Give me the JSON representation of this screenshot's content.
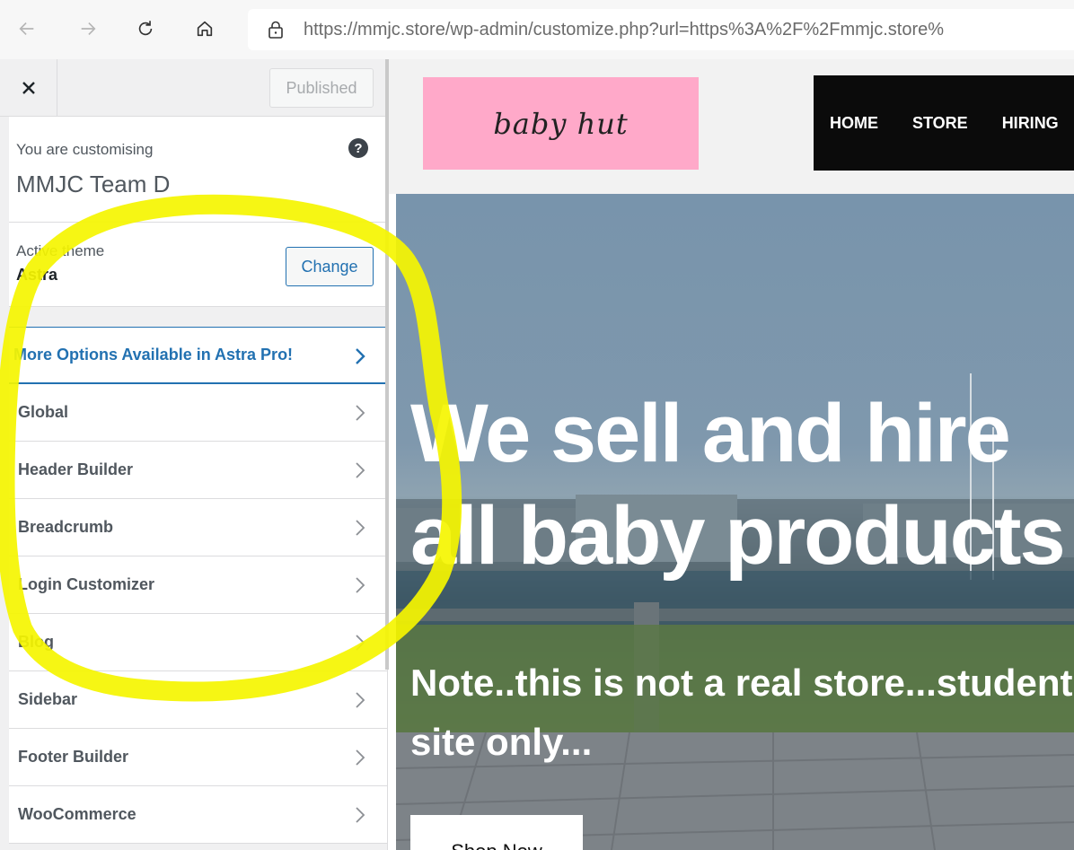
{
  "browser": {
    "url_host": "https://mmjc.store",
    "url_path": "/wp-admin/customize.php?url=https%3A%2F%2Fmmjc.store%"
  },
  "sidebar": {
    "publish_label": "Published",
    "customising_label": "You are customising",
    "site_name": "MMJC Team D",
    "active_theme_label": "Active theme",
    "theme_name": "Astra",
    "change_label": "Change",
    "items": [
      {
        "label": "More Options Available in Astra Pro!"
      },
      {
        "label": "Global"
      },
      {
        "label": "Header Builder"
      },
      {
        "label": "Breadcrumb"
      },
      {
        "label": "Login Customizer"
      },
      {
        "label": "Blog"
      },
      {
        "label": "Sidebar"
      },
      {
        "label": "Footer Builder"
      },
      {
        "label": "WooCommerce"
      }
    ]
  },
  "preview": {
    "logo_text": "baby hut",
    "nav": [
      "HOME",
      "STORE",
      "HIRING"
    ],
    "hero_line1": "We sell and hire",
    "hero_line2": "all baby products",
    "hero_sub1": "Note..this is not a real store...student",
    "hero_sub2": "site only...",
    "shop_label": "Shop Now"
  },
  "colors": {
    "accent": "#2271b1",
    "logo_bg": "#ffa9c9",
    "nav_bg": "#0b0b0b",
    "annotation": "#f5f500"
  }
}
